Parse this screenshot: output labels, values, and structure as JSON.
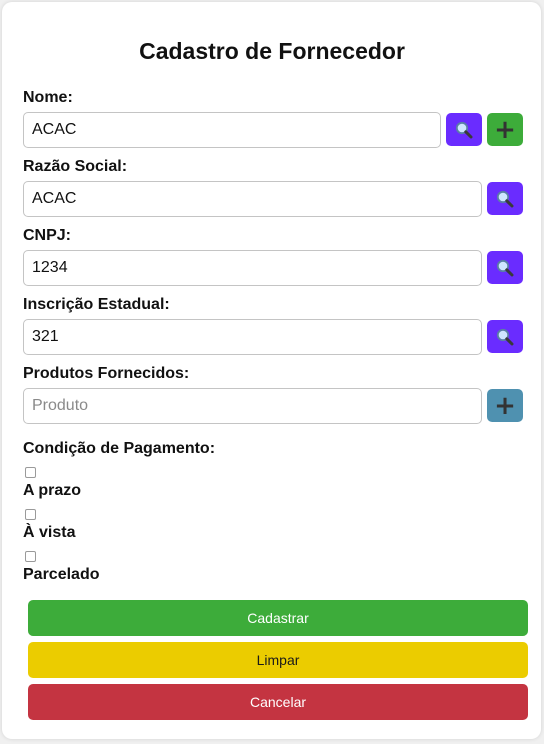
{
  "form": {
    "title": "Cadastro de Fornecedor",
    "fields": {
      "nome": {
        "label": "Nome:",
        "value": "ACAC"
      },
      "razao_social": {
        "label": "Razão Social:",
        "value": "ACAC"
      },
      "cnpj": {
        "label": "CNPJ:",
        "value": "1234"
      },
      "inscricao_estadual": {
        "label": "Inscrição Estadual:",
        "value": "321"
      },
      "produtos": {
        "label": "Produtos Fornecidos:",
        "value": "",
        "placeholder": "Produto"
      }
    },
    "pagamento": {
      "label": "Condição de Pagamento:",
      "options": [
        {
          "label": "A prazo",
          "checked": false
        },
        {
          "label": "À vista",
          "checked": false
        },
        {
          "label": "Parcelado",
          "checked": false
        }
      ]
    },
    "buttons": {
      "cadastrar": "Cadastrar",
      "limpar": "Limpar",
      "cancelar": "Cancelar"
    }
  },
  "icons": {
    "search": "magnifier-icon",
    "add": "plus-icon"
  },
  "colors": {
    "search_button": "#6a2cff",
    "add_button": "#3dac3a",
    "add_product_button": "#4f91b0",
    "cadastrar": "#3dac3a",
    "limpar": "#ebcc00",
    "cancelar": "#c43441"
  }
}
